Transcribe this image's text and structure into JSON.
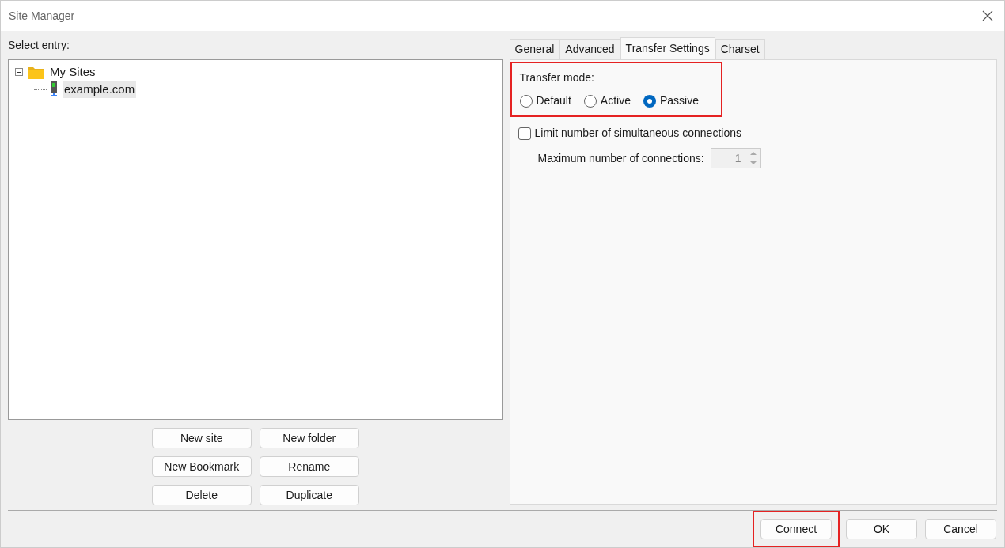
{
  "window": {
    "title": "Site Manager"
  },
  "select_label": "Select entry:",
  "tree": [
    {
      "label": "My Sites",
      "kind": "folder",
      "expanded": true,
      "selected": false,
      "children": [
        {
          "label": "example.com",
          "kind": "site",
          "selected": true
        }
      ]
    }
  ],
  "entry_buttons": [
    [
      "New site",
      "New folder"
    ],
    [
      "New Bookmark",
      "Rename"
    ],
    [
      "Delete",
      "Duplicate"
    ]
  ],
  "tabs": [
    {
      "label": "General",
      "selected": false
    },
    {
      "label": "Advanced",
      "selected": false
    },
    {
      "label": "Transfer Settings",
      "selected": true
    },
    {
      "label": "Charset",
      "selected": false
    }
  ],
  "transfer_mode": {
    "label": "Transfer mode:",
    "highlighted": true,
    "options": [
      {
        "label": "Default",
        "selected": false
      },
      {
        "label": "Active",
        "selected": false
      },
      {
        "label": "Passive",
        "selected": true
      }
    ]
  },
  "limit_connections": {
    "label": "Limit number of simultaneous connections",
    "checked": false
  },
  "max_connections": {
    "label": "Maximum number of connections:",
    "value": "1",
    "disabled": true
  },
  "footer_buttons": [
    {
      "label": "Connect",
      "highlighted": true
    },
    {
      "label": "OK",
      "highlighted": false
    },
    {
      "label": "Cancel",
      "highlighted": false
    }
  ]
}
